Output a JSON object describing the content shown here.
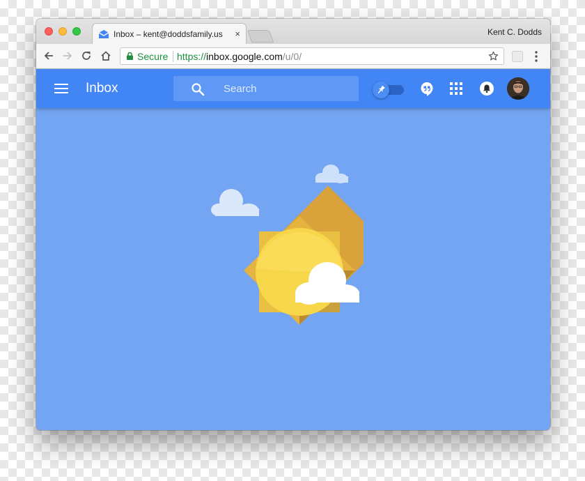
{
  "browser": {
    "tab": {
      "title": "Inbox – kent@doddsfamily.us",
      "close_glyph": "×",
      "icon": "inbox-favicon-icon"
    },
    "profile_name": "Kent C. Dodds",
    "omnibox": {
      "security_label": "Secure",
      "url_scheme": "https://",
      "url_host": "inbox.google.com",
      "url_path": "/u/0/"
    },
    "toolbar_icons": [
      "back-icon",
      "forward-icon",
      "reload-icon",
      "home-icon",
      "star-icon",
      "extension-icon",
      "menu-icon"
    ]
  },
  "app": {
    "title": "Inbox",
    "search": {
      "placeholder": "Search"
    },
    "header_icons": [
      "hamburger-icon",
      "search-icon",
      "pin-toggle",
      "hangouts-icon",
      "apps-icon",
      "bell-icon",
      "avatar"
    ],
    "fab_icon": "plus-icon"
  },
  "colors": {
    "app_bar": "#4285f4",
    "background": "#74a5f2",
    "fab": "#db4437",
    "secure_green": "#1e8e3e"
  }
}
